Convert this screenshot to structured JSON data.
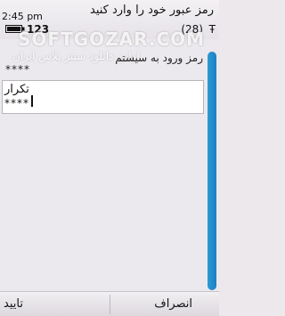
{
  "status": {
    "time": "2:45 pm",
    "input_mode": "123",
    "char_count": "(28)",
    "signal_glyph": "Ŧ"
  },
  "title": "رمز عبور خود را وارد کنید",
  "watermark": {
    "main": "SOFTGOZAR.COM",
    "sub": "اولین دانلود سنتر پلاس ایران"
  },
  "form": {
    "field1_label": "رمز ورود به سیستم",
    "field1_value": "****",
    "field2_label": "تکرار",
    "field2_value": "****"
  },
  "softkeys": {
    "left": "تایید",
    "right": "انصراف"
  },
  "colors": {
    "scrollbar": "#2d9bd6",
    "background": "#ece9ee"
  }
}
